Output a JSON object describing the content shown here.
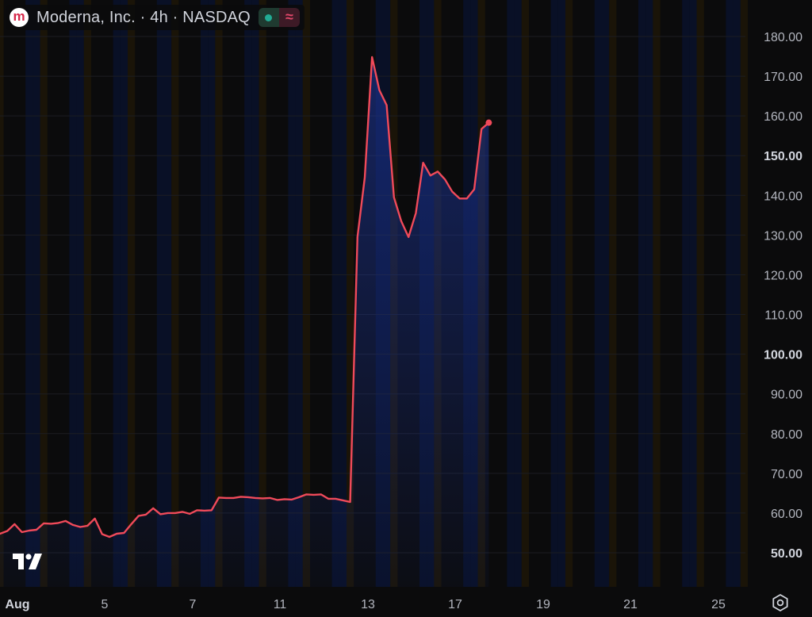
{
  "header": {
    "logo_letter": "m",
    "title": "Moderna, Inc. · 4h · NASDAQ",
    "market_status_icon": "market-open-dot-icon",
    "data_status_icon": "wave-icon",
    "data_status_glyph": "≈"
  },
  "colors": {
    "background": "#0b0b0c",
    "line": "#f04a5a",
    "area_fill": "#1a2e8a",
    "axis_text": "#b2b5be",
    "session_pre": "#1b1508",
    "session_post": "#0a1128",
    "logo_red": "#d6284a",
    "market_open": "#22ab94"
  },
  "chart_data": {
    "type": "area",
    "symbol": "Moderna, Inc.",
    "interval": "4h",
    "exchange": "NASDAQ",
    "ylim": [
      40,
      185
    ],
    "yticks": [
      "180.00",
      "170.00",
      "160.00",
      "150.00",
      "140.00",
      "130.00",
      "120.00",
      "110.00",
      "100.00",
      "90.00",
      "80.00",
      "70.00",
      "60.00",
      "50.00"
    ],
    "xticks": [
      {
        "label": "Aug",
        "bar": 0
      },
      {
        "label": "5",
        "bar": 12
      },
      {
        "label": "7",
        "bar": 24
      },
      {
        "label": "11",
        "bar": 36
      },
      {
        "label": "13",
        "bar": 48
      },
      {
        "label": "17",
        "bar": 60
      },
      {
        "label": "19",
        "bar": 72
      },
      {
        "label": "21",
        "bar": 84
      },
      {
        "label": "25",
        "bar": 96
      }
    ],
    "values": [
      54.8,
      55.5,
      57.2,
      55.2,
      55.6,
      55.8,
      57.4,
      57.3,
      57.5,
      58.0,
      57.0,
      56.5,
      56.8,
      58.6,
      54.7,
      54.0,
      54.8,
      55.0,
      57.2,
      59.3,
      59.6,
      61.2,
      59.7,
      60.0,
      60.0,
      60.3,
      59.8,
      60.7,
      60.6,
      60.7,
      63.9,
      63.8,
      63.8,
      64.1,
      64.0,
      63.8,
      63.7,
      63.8,
      63.3,
      63.5,
      63.4,
      64.0,
      64.7,
      64.6,
      64.7,
      63.6,
      63.6,
      63.2,
      62.8,
      129.5,
      144.5,
      174.8,
      166.5,
      162.7,
      139.5,
      133.5,
      129.5,
      135.5,
      148.2,
      145.0,
      146.0,
      144.0,
      140.9,
      139.2,
      139.2,
      141.5,
      156.7,
      158.3
    ]
  }
}
